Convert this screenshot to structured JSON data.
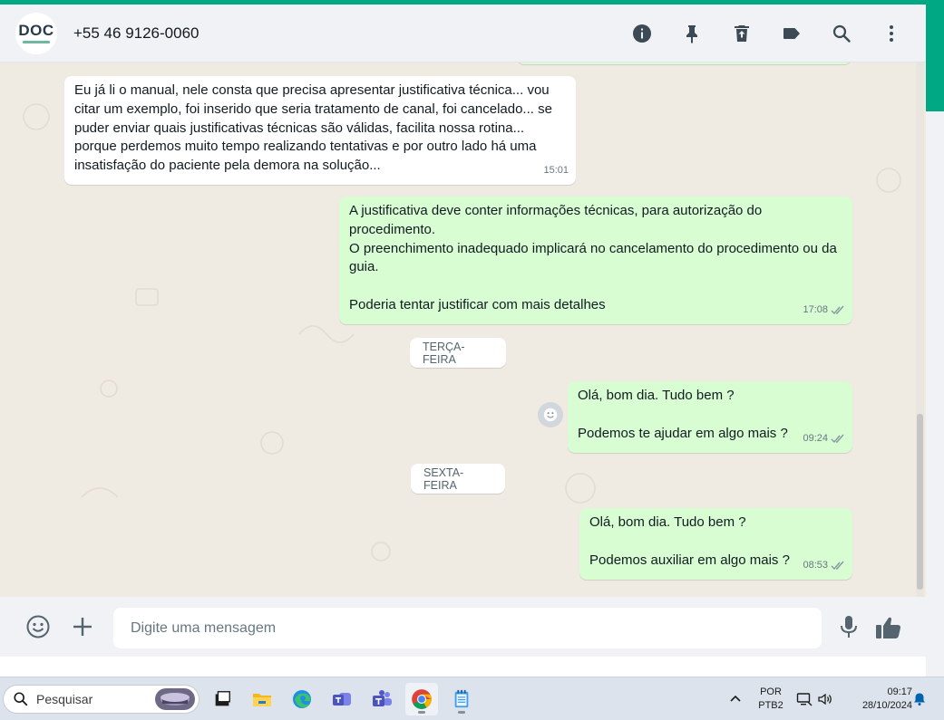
{
  "colors": {
    "accent": "#00a884",
    "incoming_bubble": "#ffffff",
    "outgoing_bubble": "#d9fdd3",
    "chat_background": "#efeae2",
    "panel_background": "#f0f2f5",
    "read_ticks": "#8696a0"
  },
  "header": {
    "avatar_text": "DOC",
    "contact_name": "+55 46 9126-0060",
    "icons": [
      "info-icon",
      "pin-icon",
      "delete-icon",
      "label-icon",
      "search-icon",
      "menu-icon"
    ]
  },
  "messages": [
    {
      "direction": "in",
      "text": "Eu já li o manual, nele consta que precisa apresentar justificativa técnica... vou citar um exemplo, foi inserido que seria tratamento de canal, foi cancelado... se puder enviar quais justificativas técnicas são válidas, facilita nossa rotina... porque perdemos muito tempo realizando tentativas e por outro lado há uma insatisfação do paciente pela demora na solução...",
      "time": "15:01"
    },
    {
      "direction": "out",
      "text": "A justificativa deve conter informações técnicas, para autorização do procedimento.\nO preenchimento inadequado implicará no cancelamento do procedimento ou da guia.\n\nPoderia tentar justificar com mais detalhes",
      "time": "17:08"
    },
    {
      "direction": "out",
      "text": "Olá, bom dia. Tudo bem ?\n\nPodemos te ajudar em algo mais ?",
      "time": "09:24"
    },
    {
      "direction": "out",
      "text": "Olá, bom dia. Tudo bem ?\n\nPodemos auxiliar em algo mais ?",
      "time": "08:53"
    }
  ],
  "date_separators": [
    "TERÇA-FEIRA",
    "SEXTA-FEIRA"
  ],
  "composer": {
    "placeholder": "Digite uma mensagem",
    "icons": [
      "emoji-icon",
      "attach-plus-icon",
      "microphone-icon",
      "thumbs-up-icon"
    ]
  },
  "taskbar": {
    "search_placeholder": "Pesquisar",
    "apps": [
      "widgets-icon",
      "file-explorer-icon",
      "edge-icon",
      "teams-icon",
      "teams-classic-icon",
      "chrome-icon",
      "notepad-icon"
    ],
    "language": "POR",
    "keyboard": "PTB2",
    "time": "09:17",
    "date": "28/10/2024"
  }
}
